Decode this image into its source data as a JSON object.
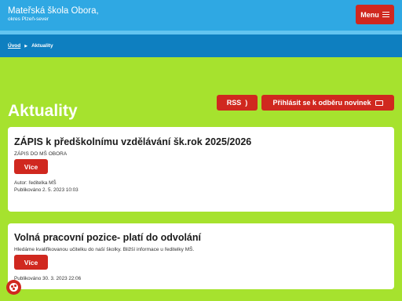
{
  "header": {
    "title": "Mateřská škola Obora,",
    "subtitle": "okres Plzeň-sever",
    "menu_label": "Menu"
  },
  "breadcrumb": {
    "home": "Úvod",
    "current": "Aktuality"
  },
  "page": {
    "title": "Aktuality",
    "rss_label": "RSS",
    "subscribe_label": "Přihlásit se k odběru novinek"
  },
  "articles": [
    {
      "title": "ZÁPIS k předškolnímu vzdělávání šk.rok 2025/2026",
      "excerpt": "ZÁPIS DO MŠ OBORA",
      "more_label": "Více",
      "author": "Autor: ředitelka MŠ",
      "published": "Publikováno 2. 5. 2023 10:03"
    },
    {
      "title": "Volná pracovní pozice- platí do odvolání",
      "excerpt": "Hledáme kvalifikovanou učitelku do naší školky. Bližší informace u ředitelky MŠ.",
      "more_label": "Více",
      "published": "Publikováno 30. 3. 2023 22:06"
    }
  ],
  "colors": {
    "background": "#a6e22e",
    "header": "#2fa8e3",
    "breadcrumb_bar": "#0e7fc0",
    "accent_red": "#d0281f"
  },
  "icons": [
    "hamburger-icon",
    "chevron-right-icon",
    "rss-icon",
    "envelope-icon",
    "cookie-icon"
  ]
}
